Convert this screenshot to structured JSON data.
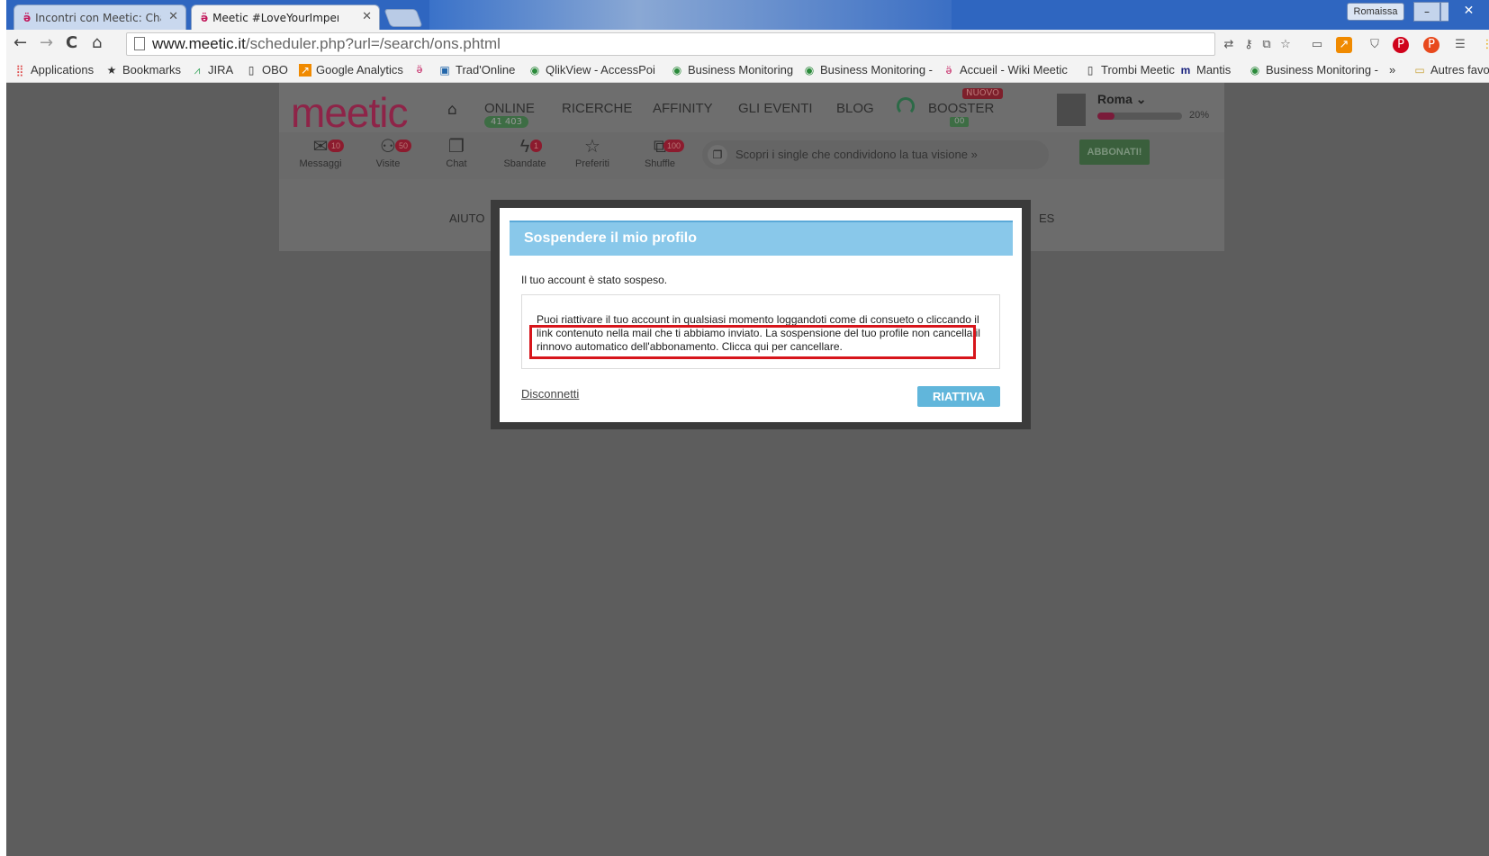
{
  "browser": {
    "tabs": [
      {
        "title": "Incontri con Meetic: Chat",
        "active": false
      },
      {
        "title": "Meetic #LoveYourImperfe",
        "active": true
      }
    ],
    "user_chip": "Romaissa",
    "url_host": "www.meetic.it",
    "url_path": "/scheduler.php?url=/search/ons.phtml"
  },
  "bookmarks": [
    {
      "label": "Applications",
      "icon": "apps-icon"
    },
    {
      "label": "Bookmarks",
      "icon": "star-icon"
    },
    {
      "label": "JIRA",
      "icon": "jira-icon"
    },
    {
      "label": "OBO",
      "icon": "page-icon"
    },
    {
      "label": "Google Analytics",
      "icon": "analytics-icon"
    },
    {
      "label": "",
      "icon": "meetic-icon"
    },
    {
      "label": "Trad'Online",
      "icon": "trad-icon"
    },
    {
      "label": "QlikView - AccessPoi",
      "icon": "qlik-icon"
    },
    {
      "label": "Business Monitoring",
      "icon": "qlik-icon"
    },
    {
      "label": "Business Monitoring -",
      "icon": "qlik-icon"
    },
    {
      "label": "Accueil - Wiki Meetic",
      "icon": "meetic-icon"
    },
    {
      "label": "Trombi Meetic",
      "icon": "page-icon"
    },
    {
      "label": "Mantis",
      "icon": "mantis-icon"
    },
    {
      "label": "Business Monitoring -",
      "icon": "qlik-icon"
    },
    {
      "label": "»",
      "icon": ""
    },
    {
      "label": "Autres favo",
      "icon": "folder-icon"
    }
  ],
  "site": {
    "brand": "meetic",
    "nav": {
      "online": "ONLINE",
      "online_count": "41 403",
      "ricerche": "RICERCHE",
      "affinity": "AFFINITY",
      "eventi": "GLI EVENTI",
      "blog": "BLOG",
      "booster": "BOOSTER",
      "booster_badge": "00",
      "nuovo": "NUOVO"
    },
    "profile": {
      "city": "Roma",
      "completion": 20,
      "completion_label": "20%"
    },
    "quick": [
      {
        "label": "Messaggi",
        "badge": "10",
        "icon": "envelope-icon"
      },
      {
        "label": "Visite",
        "badge": "50",
        "icon": "user-icon"
      },
      {
        "label": "Chat",
        "badge": "",
        "icon": "chat-icon"
      },
      {
        "label": "Sbandate",
        "badge": "1",
        "icon": "bolt-icon"
      },
      {
        "label": "Preferiti",
        "badge": "",
        "icon": "star-icon"
      },
      {
        "label": "Shuffle",
        "badge": "100",
        "icon": "shuffle-icon"
      }
    ],
    "discover": "Scopri i single che condividono la tua visione »",
    "subscribe": "ABBONATI!",
    "footer_left": "AIUTO",
    "footer_right": "ES"
  },
  "modal": {
    "title": "Sospendere il mio profilo",
    "message": "Il tuo account è stato sospeso.",
    "info": "Puoi riattivare il tuo account in qualsiasi momento loggandoti come di consueto o cliccando il link contenuto nella mail che ti abbiamo inviato. La sospensione del tuo profile non cancella il rinnovo automatico dell'abbonamento. Clicca qui per cancellare.",
    "disconnect": "Disconnetti",
    "reactivate": "RIATTIVA"
  },
  "colors": {
    "brand": "#8e2448",
    "modal_header": "#89c8ea",
    "reactivate": "#61b6db",
    "highlight": "#d7151b",
    "overlay": "#5d5d5d"
  }
}
